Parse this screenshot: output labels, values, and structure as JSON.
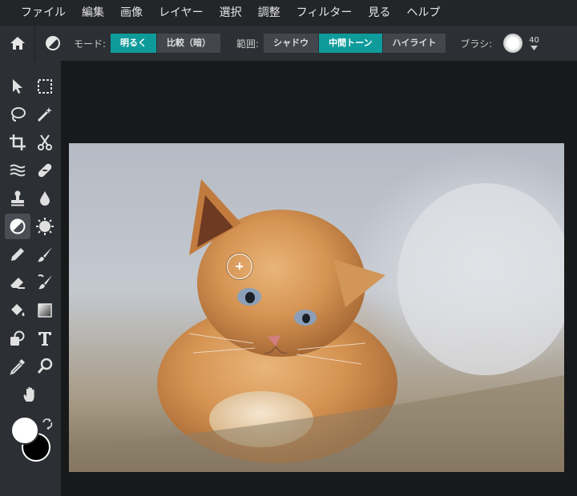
{
  "menu": [
    "ファイル",
    "編集",
    "画像",
    "レイヤー",
    "選択",
    "調整",
    "フィルター",
    "見る",
    "ヘルプ"
  ],
  "options": {
    "mode_label": "モード:",
    "mode_buttons": [
      "明るく",
      "比較（暗）"
    ],
    "mode_active": 0,
    "range_label": "範囲:",
    "range_buttons": [
      "シャドウ",
      "中間トーン",
      "ハイライト"
    ],
    "range_active": 1,
    "brush_label": "ブラシ:",
    "brush_size": "40"
  },
  "tools": [
    {
      "name": "move-tool-icon"
    },
    {
      "name": "marquee-tool-icon"
    },
    {
      "name": "lasso-tool-icon"
    },
    {
      "name": "magic-wand-tool-icon"
    },
    {
      "name": "crop-tool-icon"
    },
    {
      "name": "cut-tool-icon"
    },
    {
      "name": "liquify-tool-icon"
    },
    {
      "name": "healing-tool-icon"
    },
    {
      "name": "clone-stamp-tool-icon"
    },
    {
      "name": "blur-tool-icon"
    },
    {
      "name": "dodge-burn-tool-icon",
      "active": true
    },
    {
      "name": "sponge-tool-icon"
    },
    {
      "name": "pencil-tool-icon"
    },
    {
      "name": "brush-tool-icon"
    },
    {
      "name": "eraser-tool-icon"
    },
    {
      "name": "color-replace-tool-icon"
    },
    {
      "name": "paint-bucket-tool-icon"
    },
    {
      "name": "gradient-tool-icon"
    },
    {
      "name": "shape-tool-icon"
    },
    {
      "name": "text-tool-icon"
    },
    {
      "name": "eyedropper-tool-icon"
    },
    {
      "name": "zoom-tool-icon"
    },
    {
      "name": "hand-tool-icon"
    }
  ],
  "colors": {
    "foreground": "#ffffff",
    "background": "#000000",
    "accent": "#109b9b"
  }
}
